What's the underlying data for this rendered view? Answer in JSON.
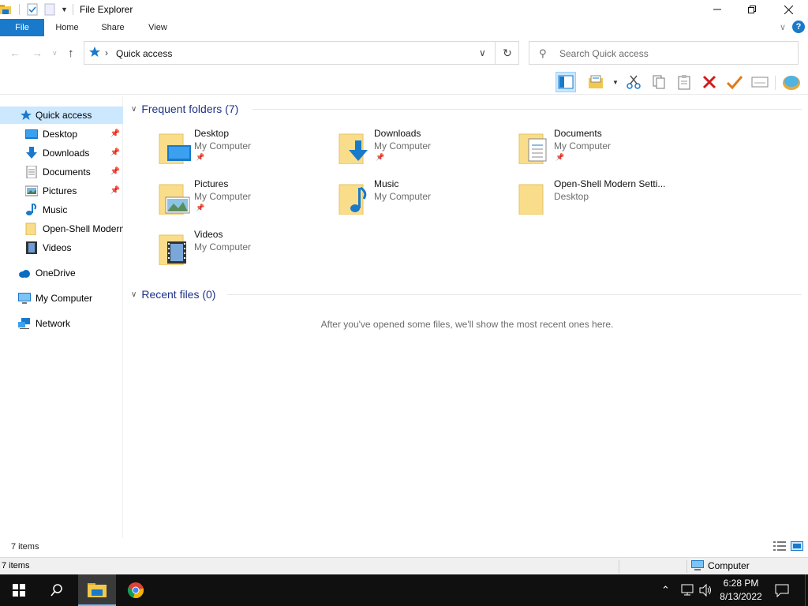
{
  "window": {
    "title": "File Explorer",
    "minimize_icon": "minimize-icon",
    "maximize_icon": "restore-icon",
    "close_icon": "close-icon"
  },
  "ribbon": {
    "tabs": [
      "File",
      "Home",
      "Share",
      "View"
    ],
    "accent_color": "#1979ca"
  },
  "address": {
    "path": "Quick access",
    "search_placeholder": "Search Quick access"
  },
  "nav": {
    "items": [
      {
        "label": "Quick access",
        "icon": "star-icon",
        "selected": true
      },
      {
        "label": "Desktop",
        "icon": "desktop-icon",
        "pinned": true
      },
      {
        "label": "Downloads",
        "icon": "download-arrow-icon",
        "pinned": true
      },
      {
        "label": "Documents",
        "icon": "document-icon",
        "pinned": true
      },
      {
        "label": "Pictures",
        "icon": "picture-icon",
        "pinned": true
      },
      {
        "label": "Music",
        "icon": "music-note-icon"
      },
      {
        "label": "Open-Shell Modern",
        "icon": "folder-icon"
      },
      {
        "label": "Videos",
        "icon": "film-icon"
      },
      {
        "label": "OneDrive",
        "icon": "cloud-icon"
      },
      {
        "label": "My Computer",
        "icon": "computer-icon"
      },
      {
        "label": "Network",
        "icon": "network-icon"
      }
    ]
  },
  "content": {
    "frequent_header": "Frequent folders (7)",
    "recent_header": "Recent files (0)",
    "recent_empty": "After you've opened some files, we'll show the most recent ones here.",
    "folders": [
      {
        "name": "Desktop",
        "location": "My Computer",
        "pinned": true,
        "overlay": "desktop"
      },
      {
        "name": "Downloads",
        "location": "My Computer",
        "pinned": true,
        "overlay": "download"
      },
      {
        "name": "Documents",
        "location": "My Computer",
        "pinned": true,
        "overlay": "document"
      },
      {
        "name": "Pictures",
        "location": "My Computer",
        "pinned": true,
        "overlay": "picture"
      },
      {
        "name": "Music",
        "location": "My Computer",
        "pinned": false,
        "overlay": "music"
      },
      {
        "name": "Open-Shell Modern Setti...",
        "location": "Desktop",
        "pinned": false,
        "overlay": "none"
      },
      {
        "name": "Videos",
        "location": "My Computer",
        "pinned": false,
        "overlay": "video"
      }
    ]
  },
  "status": {
    "items_top": "7 items",
    "items_bottom": "7 items",
    "computer": "Computer"
  },
  "taskbar": {
    "time": "6:28 PM",
    "date": "8/13/2022"
  }
}
